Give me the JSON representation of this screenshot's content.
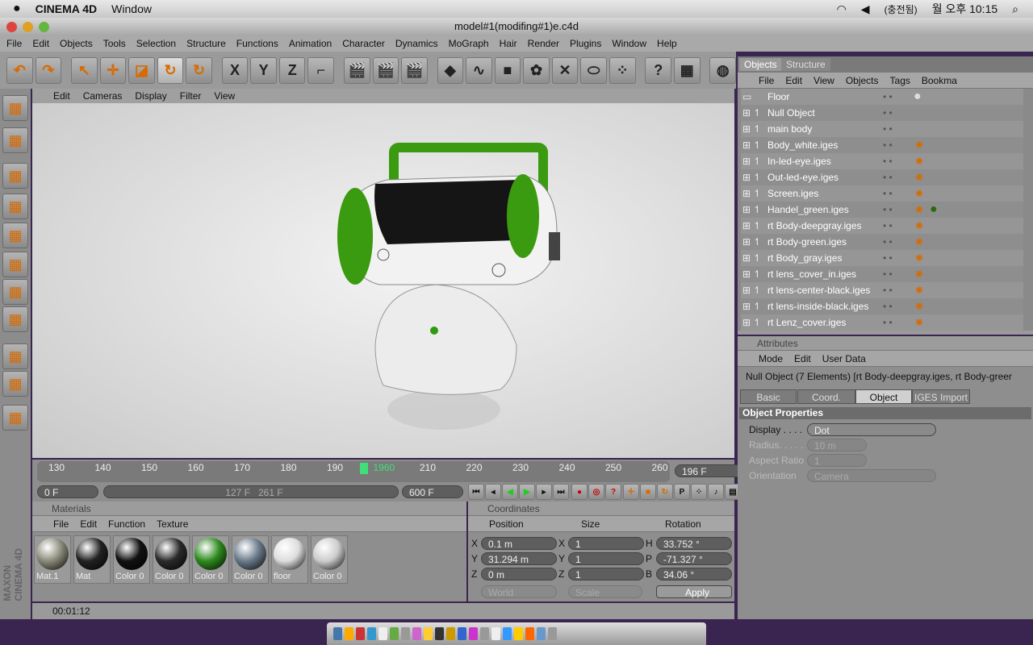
{
  "mac_menubar": {
    "app": "CINEMA 4D",
    "menu": "Window",
    "battery": "(충전됨)",
    "clock": "월 오후 10:15"
  },
  "window_title": "model#1(modifing#1)e.c4d",
  "app_menu": [
    "File",
    "Edit",
    "Objects",
    "Tools",
    "Selection",
    "Structure",
    "Functions",
    "Animation",
    "Character",
    "Dynamics",
    "MoGraph",
    "Hair",
    "Render",
    "Plugins",
    "Window",
    "Help"
  ],
  "toolbar_icons": [
    "undo-icon",
    "redo-icon",
    "live-selection-icon",
    "move-icon",
    "scale-icon",
    "rotate-icon",
    "recent-tool-icon",
    "x-axis-icon",
    "y-axis-icon",
    "z-axis-icon",
    "coordinate-system-icon",
    "render-view-icon",
    "render-picture-viewer-icon",
    "render-settings-icon",
    "cube-icon",
    "spline-icon",
    "nurbs-icon",
    "array-icon",
    "deformer-icon",
    "scene-icon",
    "particle-icon",
    "help-icon",
    "render-setup-icon",
    "web-icon"
  ],
  "viewport": {
    "menu": [
      "Edit",
      "Cameras",
      "Display",
      "Filter",
      "View"
    ]
  },
  "timeline": {
    "ticks": [
      "130",
      "140",
      "150",
      "160",
      "170",
      "180",
      "190",
      "1960",
      "210",
      "220",
      "230",
      "240",
      "250",
      "260"
    ],
    "current_frame": "196 F",
    "start": "0 F",
    "range_start": "127 F",
    "range_end": "261 F",
    "end": "600 F",
    "accent": "#3fe07a"
  },
  "materials": {
    "title": "Materials",
    "menu": [
      "File",
      "Edit",
      "Function",
      "Texture"
    ],
    "items": [
      {
        "name": "Mat.1",
        "color": "#8a8a7a"
      },
      {
        "name": "Mat",
        "color": "#222222"
      },
      {
        "name": "Color 0",
        "color": "#111111"
      },
      {
        "name": "Color 0",
        "color": "#2a2a2a"
      },
      {
        "name": "Color 0",
        "color": "#2e8a1e"
      },
      {
        "name": "Color 0",
        "color": "#6a7a8a"
      },
      {
        "name": "floor",
        "color": "#dddddd"
      },
      {
        "name": "Color 0",
        "color": "#cccccc"
      }
    ]
  },
  "coordinates": {
    "title": "Coordinates",
    "headers": [
      "Position",
      "Size",
      "Rotation"
    ],
    "rows": [
      {
        "pa": "X",
        "p": "0.1 m",
        "sa": "X",
        "s": "1",
        "ra": "H",
        "r": "33.752 °"
      },
      {
        "pa": "Y",
        "p": "31.294 m",
        "sa": "Y",
        "s": "1",
        "ra": "P",
        "r": "-71.327 °"
      },
      {
        "pa": "Z",
        "p": "0 m",
        "sa": "Z",
        "s": "1",
        "ra": "B",
        "r": "34.06 °"
      }
    ],
    "mode": "World",
    "size_mode": "Scale",
    "apply": "Apply"
  },
  "status": "00:01:12",
  "objects": {
    "tabs": [
      "Objects",
      "Structure"
    ],
    "menu": [
      "File",
      "Edit",
      "View",
      "Objects",
      "Tags",
      "Bookma"
    ],
    "items": [
      "Floor",
      "Null Object",
      "main body",
      "Body_white.iges",
      "In-led-eye.iges",
      "Out-led-eye.iges",
      "Screen.iges",
      "Handel_green.iges",
      "rt Body-deepgray.iges",
      "rt Body-green.iges",
      "rt Body_gray.iges",
      "rt lens_cover_in.iges",
      "rt lens-center-black.iges",
      "rt lens-inside-black.iges",
      "rt Lenz_cover.iges"
    ]
  },
  "attributes": {
    "title": "Attributes",
    "menu": [
      "Mode",
      "Edit",
      "User Data"
    ],
    "object_label": "Null Object (7 Elements) [rt Body-deepgray.iges, rt Body-greer",
    "tabs": [
      "Basic",
      "Coord.",
      "Object",
      "IGES Import"
    ],
    "active_tab": "Object",
    "section": "Object Properties",
    "fields": [
      {
        "label": "Display . . . .",
        "value": "Dot"
      },
      {
        "label": "Radius. . . . .",
        "value": "10 m"
      },
      {
        "label": "Aspect Ratio",
        "value": "1"
      },
      {
        "label": "Orientation",
        "value": "Camera"
      }
    ]
  },
  "branding": "MAXON CINEMA 4D"
}
